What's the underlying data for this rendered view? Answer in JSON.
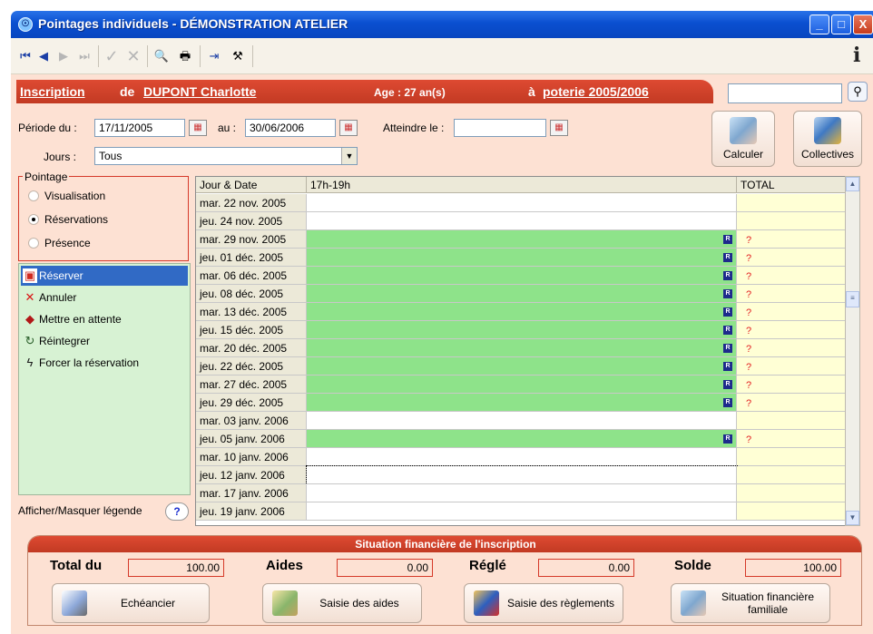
{
  "window": {
    "title": "Pointages individuels - DÉMONSTRATION ATELIER",
    "icon": "app-logo-icon",
    "controls": {
      "minimize": "_",
      "maximize": "□",
      "close": "X"
    }
  },
  "toolbar": {
    "first": "⏮",
    "prev": "◀",
    "next": "▶",
    "last": "⏭",
    "validate": "✓",
    "cancel": "✕",
    "search": "🔍",
    "print": "🖶",
    "exit": "⇥",
    "tools": "⚒"
  },
  "header": {
    "inscription_label": "Inscription",
    "de": "de",
    "person_name": "DUPONT Charlotte",
    "age_text": "Age : 27 an(s)",
    "a_label": "à",
    "activity": "poterie 2005/2006",
    "search_value": ""
  },
  "filters": {
    "periode_label": "Période du :",
    "date_from": "17/11/2005",
    "au_label": "au :",
    "date_to": "30/06/2006",
    "atteindre_label": "Atteindre le :",
    "atteindre_value": "",
    "jours_label": "Jours :",
    "jours_value": "Tous"
  },
  "actions_buttons": {
    "calculer": "Calculer",
    "collectives": "Collectives"
  },
  "pointage": {
    "legend": "Pointage",
    "options": [
      "Visualisation",
      "Réservations",
      "Présence"
    ],
    "selected": "Réservations"
  },
  "actions": {
    "items": [
      {
        "label": "Réserver",
        "icon": "calendar-icon",
        "glyph": "▣",
        "color": "#d02a20"
      },
      {
        "label": "Annuler",
        "icon": "cross-icon",
        "glyph": "✕",
        "color": "#d81414"
      },
      {
        "label": "Mettre en attente",
        "icon": "pin-icon",
        "glyph": "◆",
        "color": "#b21818"
      },
      {
        "label": "Réintegrer",
        "icon": "reintegrate-icon",
        "glyph": "↻",
        "color": "#2a5e2a"
      },
      {
        "label": "Forcer la réservation",
        "icon": "lightning-icon",
        "glyph": "ϟ",
        "color": "#1c1c1c"
      }
    ],
    "selected_index": 0
  },
  "legend_toggle": {
    "label": "Afficher/Masquer légende",
    "button": "?"
  },
  "grid": {
    "headers": [
      "Jour & Date",
      "17h-19h",
      "TOTAL"
    ],
    "rows": [
      {
        "date": "mar. 22 nov. 2005",
        "reserved": false,
        "total": ""
      },
      {
        "date": "jeu. 24 nov. 2005",
        "reserved": false,
        "total": ""
      },
      {
        "date": "mar. 29 nov. 2005",
        "reserved": true,
        "total": "?"
      },
      {
        "date": "jeu. 01 déc. 2005",
        "reserved": true,
        "total": "?"
      },
      {
        "date": "mar. 06 déc. 2005",
        "reserved": true,
        "total": "?"
      },
      {
        "date": "jeu. 08 déc. 2005",
        "reserved": true,
        "total": "?"
      },
      {
        "date": "mar. 13 déc. 2005",
        "reserved": true,
        "total": "?"
      },
      {
        "date": "jeu. 15 déc. 2005",
        "reserved": true,
        "total": "?"
      },
      {
        "date": "mar. 20 déc. 2005",
        "reserved": true,
        "total": "?"
      },
      {
        "date": "jeu. 22 déc. 2005",
        "reserved": true,
        "total": "?"
      },
      {
        "date": "mar. 27 déc. 2005",
        "reserved": true,
        "total": "?"
      },
      {
        "date": "jeu. 29 déc. 2005",
        "reserved": true,
        "total": "?"
      },
      {
        "date": "mar. 03 janv. 2006",
        "reserved": false,
        "total": ""
      },
      {
        "date": "jeu. 05 janv. 2006",
        "reserved": true,
        "total": "?"
      },
      {
        "date": "mar. 10 janv. 2006",
        "reserved": false,
        "total": ""
      },
      {
        "date": "jeu. 12 janv. 2006",
        "reserved": false,
        "total": "",
        "focused": true
      },
      {
        "date": "mar. 17 janv. 2006",
        "reserved": false,
        "total": ""
      },
      {
        "date": "jeu. 19 janv. 2006",
        "reserved": false,
        "total": ""
      }
    ],
    "badge": "R",
    "colors": {
      "reserved": "#8ee38a",
      "total_bg": "#ffffd5",
      "header_bg": "#ece9d8"
    }
  },
  "finance": {
    "title": "Situation financière de l'inscription",
    "total_du_label": "Total du",
    "total_du": "100.00",
    "aides_label": "Aides",
    "aides": "0.00",
    "regle_label": "Réglé",
    "regle": "0.00",
    "solde_label": "Solde",
    "solde": "100.00",
    "buttons": {
      "echeancier": "Echéancier",
      "saisie_aides": "Saisie des aides",
      "saisie_reglements": "Saisie des règlements",
      "situation_familiale": "Situation financière familiale"
    }
  },
  "help_glyph": "i",
  "colors": {
    "accent": "#d53a2a",
    "panel": "#fde1d3",
    "selection": "#316ac5",
    "titlebar": "#0a4fd0"
  }
}
